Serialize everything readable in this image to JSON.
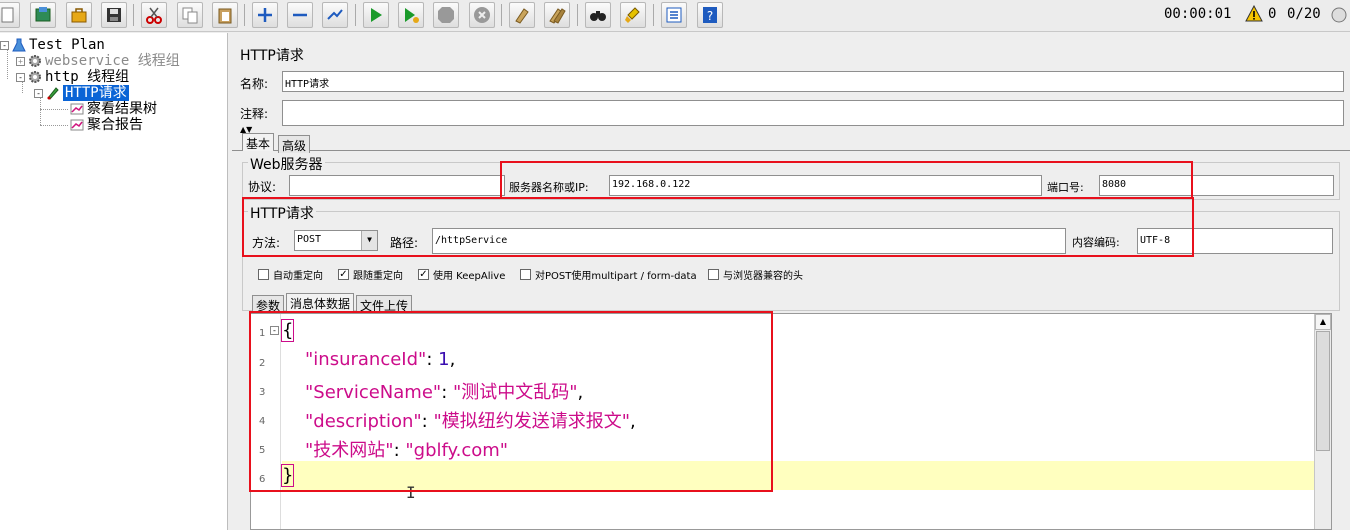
{
  "toolbar": {
    "buttons": [
      "new-icon",
      "templates-icon",
      "open-icon",
      "save-icon",
      "cut-icon",
      "copy-icon",
      "paste-icon",
      "expand-icon",
      "collapse-icon",
      "toggle-icon",
      "start-icon",
      "start-no-pause-icon",
      "stop-icon",
      "shutdown-icon",
      "clear-icon",
      "clear-all-icon",
      "search-icon",
      "reset-search-icon",
      "function-helper-icon",
      "help-icon"
    ],
    "timer": "00:00:01",
    "error_count": "0",
    "threads": "0/20"
  },
  "tree": {
    "items": [
      {
        "label": "Test Plan"
      },
      {
        "label": "webservice 线程组"
      },
      {
        "label": "http 线程组"
      },
      {
        "label": "HTTP请求"
      },
      {
        "label": "察看结果树"
      },
      {
        "label": "聚合报告"
      }
    ]
  },
  "panel": {
    "title": "HTTP请求",
    "name_label": "名称:",
    "name_value": "HTTP请求",
    "comment_label": "注释:",
    "comment_value": "",
    "tabs": [
      "基本",
      "高级"
    ],
    "web_server": {
      "title": "Web服务器",
      "protocol_label": "协议:",
      "protocol_value": "",
      "server_label": "服务器名称或IP:",
      "server_value": "192.168.0.122",
      "port_label": "端口号:",
      "port_value": "8080"
    },
    "http_request": {
      "title": "HTTP请求",
      "method_label": "方法:",
      "method_value": "POST",
      "path_label": "路径:",
      "path_value": "/httpService",
      "encoding_label": "内容编码:",
      "encoding_value": "UTF-8"
    },
    "checkboxes": [
      {
        "label": "自动重定向",
        "checked": false
      },
      {
        "label": "跟随重定向",
        "checked": true
      },
      {
        "label": "使用 KeepAlive",
        "checked": true
      },
      {
        "label": "对POST使用multipart / form-data",
        "checked": false
      },
      {
        "label": "与浏览器兼容的头",
        "checked": false
      }
    ],
    "body_tabs": [
      "参数",
      "消息体数据",
      "文件上传"
    ]
  },
  "editor": {
    "line_numbers": [
      "1",
      "2",
      "3",
      "4",
      "5",
      "6"
    ],
    "line1_open": "{",
    "line2_key": "\"insuranceId\"",
    "line2_val": "1",
    "line3_key": "\"ServiceName\"",
    "line3_val": "\"测试中文乱码\"",
    "line4_key": "\"description\"",
    "line4_val": "\"模拟纽约发送请求报文\"",
    "line5_key": "\"技术网站\"",
    "line5_val": "\"gblfy.com\"",
    "line6_close": "}",
    "colon": ": ",
    "comma": ","
  },
  "colors": {
    "highlight_red": "#e8101c",
    "selection_blue": "#0a64d6",
    "json_key": "#cc0c8a",
    "json_number": "#3a0db0",
    "current_line": "#ffffbf"
  }
}
